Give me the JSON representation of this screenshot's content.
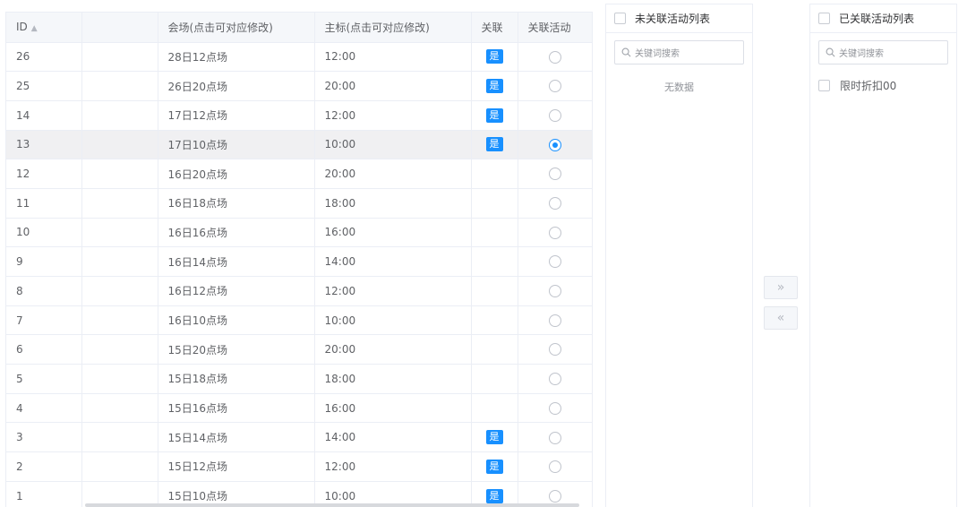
{
  "table": {
    "headers": {
      "id": "ID",
      "blank": "",
      "venue": "会场(点击可对应修改)",
      "main": "主标(点击可对应修改)",
      "linked": "关联",
      "link_activity": "关联活动"
    },
    "rows": [
      {
        "id": "26",
        "venue": "28日12点场",
        "time": "12:00",
        "linked": "是",
        "selected": false
      },
      {
        "id": "25",
        "venue": "26日20点场",
        "time": "20:00",
        "linked": "是",
        "selected": false
      },
      {
        "id": "14",
        "venue": "17日12点场",
        "time": "12:00",
        "linked": "是",
        "selected": false
      },
      {
        "id": "13",
        "venue": "17日10点场",
        "time": "10:00",
        "linked": "是",
        "selected": true
      },
      {
        "id": "12",
        "venue": "16日20点场",
        "time": "20:00",
        "linked": "",
        "selected": false
      },
      {
        "id": "11",
        "venue": "16日18点场",
        "time": "18:00",
        "linked": "",
        "selected": false
      },
      {
        "id": "10",
        "venue": "16日16点场",
        "time": "16:00",
        "linked": "",
        "selected": false
      },
      {
        "id": "9",
        "venue": "16日14点场",
        "time": "14:00",
        "linked": "",
        "selected": false
      },
      {
        "id": "8",
        "venue": "16日12点场",
        "time": "12:00",
        "linked": "",
        "selected": false
      },
      {
        "id": "7",
        "venue": "16日10点场",
        "time": "10:00",
        "linked": "",
        "selected": false
      },
      {
        "id": "6",
        "venue": "15日20点场",
        "time": "20:00",
        "linked": "",
        "selected": false
      },
      {
        "id": "5",
        "venue": "15日18点场",
        "time": "18:00",
        "linked": "",
        "selected": false
      },
      {
        "id": "4",
        "venue": "15日16点场",
        "time": "16:00",
        "linked": "",
        "selected": false
      },
      {
        "id": "3",
        "venue": "15日14点场",
        "time": "14:00",
        "linked": "是",
        "selected": false
      },
      {
        "id": "2",
        "venue": "15日12点场",
        "time": "12:00",
        "linked": "是",
        "selected": false
      },
      {
        "id": "1",
        "venue": "15日10点场",
        "time": "10:00",
        "linked": "是",
        "selected": false
      }
    ]
  },
  "transfer": {
    "left": {
      "title": "未关联活动列表",
      "search_placeholder": "关键词搜索",
      "empty_text": "无数据"
    },
    "right": {
      "title": "已关联活动列表",
      "search_placeholder": "关键词搜索",
      "items": [
        "限时折扣00"
      ]
    },
    "move_right_label": "»",
    "move_left_label": "«"
  },
  "colors": {
    "accent": "#1890ff",
    "selected_row": "#f0f0f2"
  }
}
